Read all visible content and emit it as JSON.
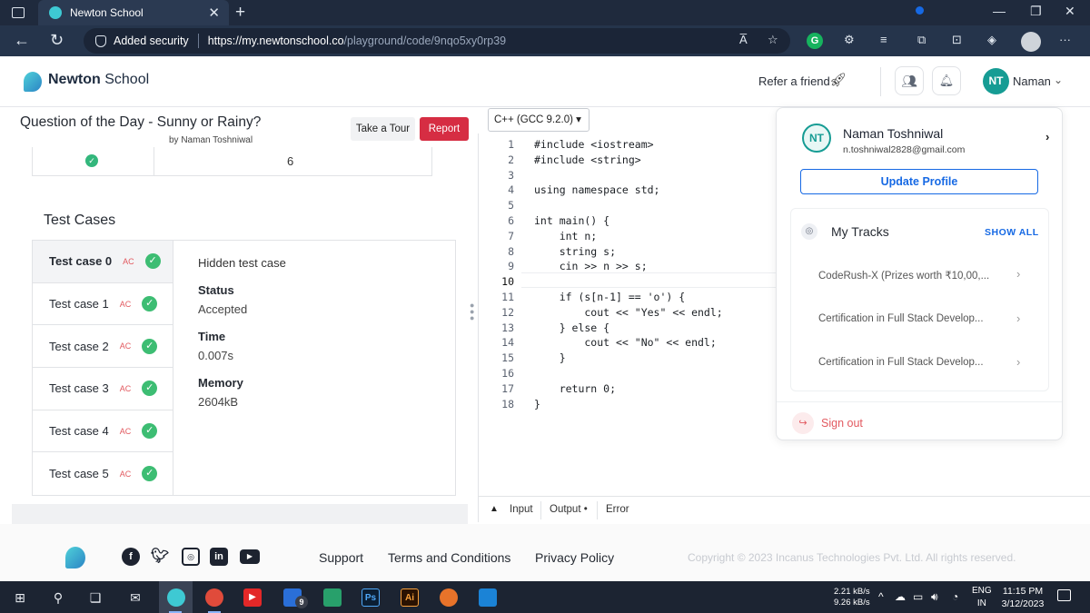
{
  "browser": {
    "tab_title": "Newton School",
    "tab_close": "✕",
    "new_tab": "+",
    "security_label": "Added security",
    "url_host": "https://my.newtonschool.co",
    "url_path": "/playground/code/9nqo5xy0rp39",
    "read_aloud": "A̅",
    "grammarly": "G"
  },
  "header": {
    "brand_bold": "Newton",
    "brand_rest": " School",
    "refer_label": "Refer a friend",
    "user_initials": "NT",
    "user_name": "Naman"
  },
  "question": {
    "title": "Question of the Day - Sunny or Rainy?",
    "author": "by Naman Toshniwal",
    "tour_label": "Take a Tour",
    "report_label": "Report",
    "top_value": "6"
  },
  "test_cases": {
    "heading": "Test Cases",
    "items": [
      {
        "name": "Test case 0",
        "verdict": "AC"
      },
      {
        "name": "Test case 1",
        "verdict": "AC"
      },
      {
        "name": "Test case 2",
        "verdict": "AC"
      },
      {
        "name": "Test case 3",
        "verdict": "AC"
      },
      {
        "name": "Test case 4",
        "verdict": "AC"
      },
      {
        "name": "Test case 5",
        "verdict": "AC"
      }
    ],
    "detail": {
      "hidden": "Hidden test case",
      "status_label": "Status",
      "status_value": "Accepted",
      "time_label": "Time",
      "time_value": "0.007s",
      "memory_label": "Memory",
      "memory_value": "2604kB"
    }
  },
  "editor": {
    "language": "C++ (GCC 9.2.0)",
    "lines": [
      "#include <iostream>",
      "#include <string>",
      "",
      "using namespace std;",
      "",
      "int main() {",
      "    int n;",
      "    string s;",
      "    cin >> n >> s;",
      "",
      "    if (s[n-1] == 'o') {",
      "        cout << \"Yes\" << endl;",
      "    } else {",
      "        cout << \"No\" << endl;",
      "    }",
      "",
      "    return 0;",
      "}"
    ],
    "console_tabs": [
      "Input",
      "Output •",
      "Error"
    ]
  },
  "profile_menu": {
    "initials": "NT",
    "name": "Naman Toshniwal",
    "email": "n.toshniwal2828@gmail.com",
    "update_label": "Update Profile",
    "tracks_title": "My Tracks",
    "show_all": "SHOW ALL",
    "tracks": [
      "CodeRush-X (Prizes worth ₹10,00,...",
      "Certification in Full Stack Develop...",
      "Certification in Full Stack Develop..."
    ],
    "signout_label": "Sign out"
  },
  "footer": {
    "links": [
      "Support",
      "Terms and Conditions",
      "Privacy Policy"
    ],
    "copyright": "Copyright © 2023 Incanus Technologies Pvt. Ltd. All rights reserved."
  },
  "taskbar": {
    "badge": "9",
    "ps_label": "Ps",
    "ai_label": "Ai",
    "net_up": "2.21 kB/s",
    "net_down": "9.26 kB/s",
    "lang_1": "ENG",
    "lang_2": "IN",
    "time": "11:15 PM",
    "date": "3/12/2023"
  }
}
